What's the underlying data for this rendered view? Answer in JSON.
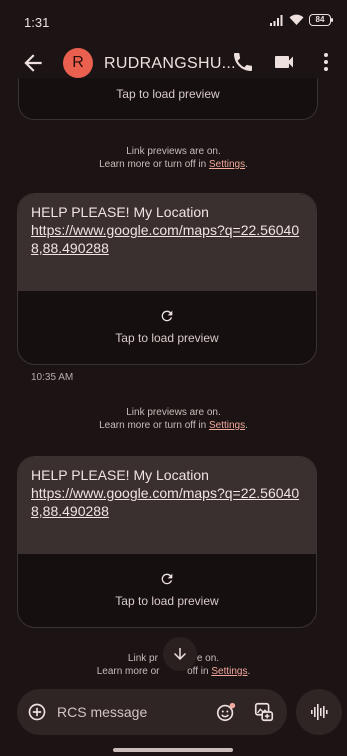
{
  "status_bar": {
    "time": "1:31",
    "battery": "84"
  },
  "header": {
    "avatar_letter": "R",
    "contact_name": "RUDRANGSHU..."
  },
  "top_preview": {
    "label": "Tap to load preview"
  },
  "notices": [
    {
      "line1": "Link previews are on.",
      "line2_prefix": "Learn more or turn off in ",
      "link": "Settings",
      "suffix": "."
    },
    {
      "line1": "Link previews are on.",
      "line2_prefix": "Learn more or turn off in ",
      "link": "Settings",
      "suffix": "."
    },
    {
      "line1": "Link pr",
      "line1_tail": "are on.",
      "line2_prefix": "Learn more or ",
      "line2_tail": " off in ",
      "link": "Settings",
      "suffix": "."
    }
  ],
  "messages": [
    {
      "text": "HELP PLEASE! My Location",
      "link": "https://www.google.com/maps?q=22.560408,88.490288",
      "preview_label": "Tap to load preview",
      "timestamp": "10:35 AM"
    },
    {
      "text": "HELP PLEASE! My Location",
      "link": "https://www.google.com/maps?q=22.560408,88.490288",
      "preview_label": "Tap to load preview"
    }
  ],
  "composer": {
    "placeholder": "RCS message"
  },
  "icons": {
    "back": "arrow-left-icon",
    "call": "phone-icon",
    "video": "video-icon",
    "more": "more-vert-icon",
    "reload": "refresh-icon",
    "scroll": "arrow-down-icon",
    "add": "add-circle-icon",
    "emoji": "emoji-icon",
    "gallery": "gallery-icon",
    "voice": "waveform-icon"
  },
  "colors": {
    "background": "#1c1414",
    "avatar": "#e9604f",
    "link": "#f2a99d",
    "bubble": "#3a3030"
  }
}
